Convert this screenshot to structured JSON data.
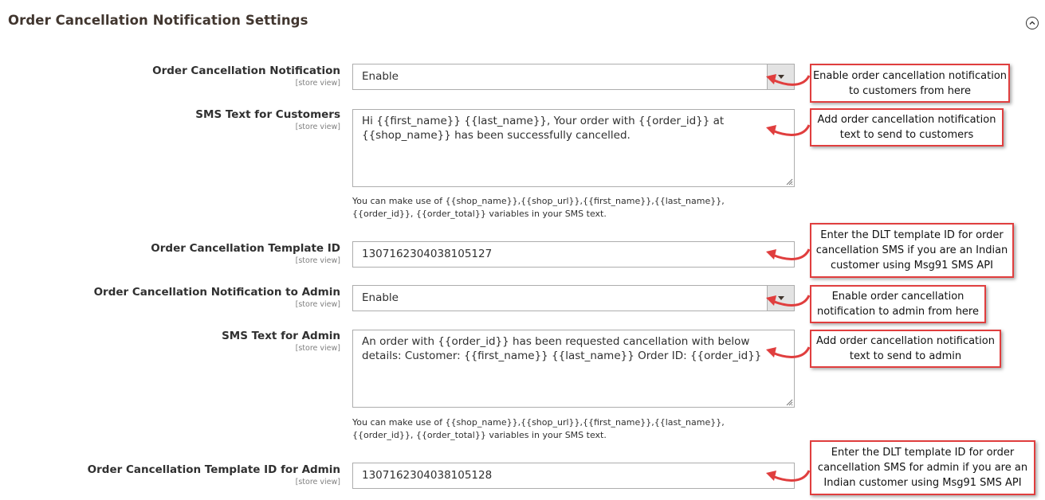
{
  "section": {
    "title": "Order Cancellation Notification Settings",
    "collapse_icon": "circle-chevron-up-icon"
  },
  "fields": {
    "notification": {
      "label": "Order Cancellation Notification",
      "scope": "[store view]",
      "value": "Enable"
    },
    "sms_text_customers": {
      "label": "SMS Text for Customers",
      "scope": "[store view]",
      "value": "Hi {{first_name}} {{last_name}}, Your order with {{order_id}} at {{shop_name}} has been successfully cancelled.",
      "note": "You can make use of {{shop_name}},{{shop_url}},{{first_name}},{{last_name}},{{order_id}}, {{order_total}} variables in your SMS text."
    },
    "template_id": {
      "label": "Order Cancellation Template ID",
      "scope": "[store view]",
      "value": "1307162304038105127"
    },
    "notification_admin": {
      "label": "Order Cancellation Notification to Admin",
      "scope": "[store view]",
      "value": "Enable"
    },
    "sms_text_admin": {
      "label": "SMS Text for Admin",
      "scope": "[store view]",
      "value": "An order with {{order_id}} has been requested cancellation with below details: Customer: {{first_name}} {{last_name}} Order ID: {{order_id}}",
      "note": "You can make use of {{shop_name}},{{shop_url}},{{first_name}},{{last_name}},{{order_id}}, {{order_total}} variables in your SMS text."
    },
    "template_id_admin": {
      "label": "Order Cancellation Template ID for Admin",
      "scope": "[store view]",
      "value": "1307162304038105128"
    }
  },
  "callouts": {
    "c1": "Enable order cancellation notification to customers from here",
    "c2": "Add order cancellation notification text to send to customers",
    "c3": "Enter the DLT template ID for order cancellation SMS if you are an Indian customer using Msg91 SMS API",
    "c4": "Enable order cancellation notification to admin from here",
    "c5": "Add order cancellation notification text to send to admin",
    "c6": "Enter the DLT template ID for order cancellation SMS for admin if you are an Indian customer using Msg91 SMS API"
  },
  "colors": {
    "callout_border": "#e03e3e",
    "arrow": "#e03e3e"
  }
}
